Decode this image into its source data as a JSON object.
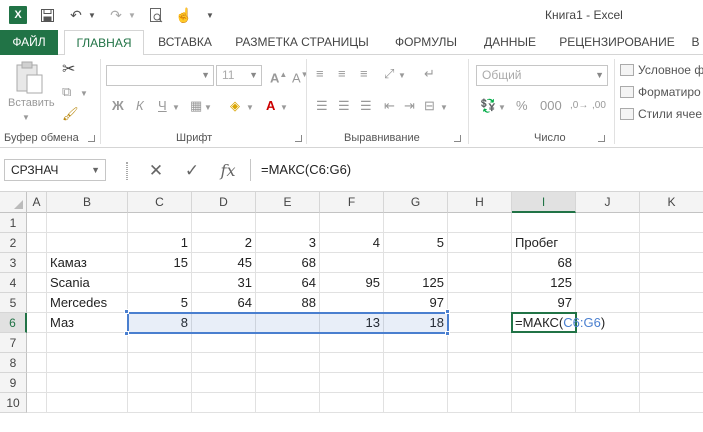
{
  "window": {
    "title": "Книга1 - Excel",
    "app_logo": "X"
  },
  "ribbon_tabs": [
    "ФАЙЛ",
    "ГЛАВНАЯ",
    "ВСТАВКА",
    "РАЗМЕТКА СТРАНИЦЫ",
    "ФОРМУЛЫ",
    "ДАННЫЕ",
    "РЕЦЕНЗИРОВАНИЕ",
    "В"
  ],
  "ribbon": {
    "paste_label": "Вставить",
    "clipboard_label": "Буфер обмена",
    "font_label": "Шрифт",
    "font_size": "11",
    "alignment_label": "Выравнивание",
    "number_label": "Число",
    "number_format": "Общий",
    "bold": "Ж",
    "italic": "К",
    "underline": "Ч",
    "cond_format": "Условное ф",
    "format_as_table": "Форматиро",
    "cell_styles": "Стили ячее"
  },
  "formula_bar": {
    "name_box": "СРЗНАЧ",
    "cancel": "✕",
    "enter": "✓",
    "fx": "fx",
    "formula": "=МАКС(C6:G6)"
  },
  "grid": {
    "columns": [
      "A",
      "B",
      "C",
      "D",
      "E",
      "F",
      "G",
      "H",
      "I",
      "J",
      "K"
    ],
    "rows": [
      "1",
      "2",
      "3",
      "4",
      "5",
      "6",
      "7",
      "8",
      "9",
      "10"
    ],
    "cells": {
      "C2": "1",
      "D2": "2",
      "E2": "3",
      "F2": "4",
      "G2": "5",
      "I2": "Пробег",
      "B3": "Камаз",
      "C3": "15",
      "D3": "45",
      "E3": "68",
      "I3": "68",
      "B4": "Scania",
      "D4": "31",
      "E4": "64",
      "F4": "95",
      "G4": "125",
      "I4": "125",
      "B5": "Mercedes",
      "C5": "5",
      "D5": "64",
      "E5": "88",
      "G5": "97",
      "I5": "97",
      "B6": "Маз",
      "C6": "8",
      "F6": "13",
      "G6": "18"
    },
    "edit_cell": {
      "prefix": "=МАКС(",
      "ref": "C6:G6",
      "suffix": ")"
    }
  },
  "colors": {
    "accent": "#217346",
    "range": "#4a7fcf"
  }
}
